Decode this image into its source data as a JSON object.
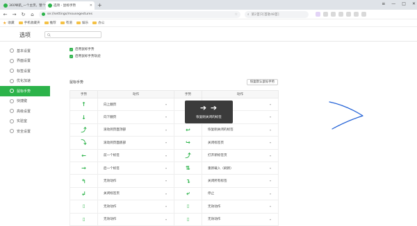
{
  "browser": {
    "tabs": [
      {
        "label": "360导航_一个主页，整个世界",
        "active": false,
        "icon_color": "#2cb34a"
      },
      {
        "label": "选项 - 鼠标手势",
        "active": true,
        "icon_color": "#2cb34a"
      }
    ],
    "new_tab": "+",
    "address": "se://settings/mousegestures",
    "search_text": "第2首只[首歌48首]",
    "bookmarks": [
      {
        "label": "收藏",
        "icon": "star-icon"
      },
      {
        "label": "手机收藏夹",
        "icon": "folder-icon"
      },
      {
        "label": "推荐",
        "icon": "folder-icon"
      },
      {
        "label": "有道",
        "icon": "folder-icon"
      },
      {
        "label": "娱乐",
        "icon": "folder-icon"
      },
      {
        "label": "办公",
        "icon": "folder-icon"
      }
    ]
  },
  "page": {
    "title": "选项",
    "search_placeholder": ""
  },
  "sidebar": {
    "items": [
      {
        "label": "基本设置",
        "active": false
      },
      {
        "label": "界面设置",
        "active": false
      },
      {
        "label": "标签设置",
        "active": false
      },
      {
        "label": "优化加速",
        "active": false
      },
      {
        "label": "鼠标手势",
        "active": true
      },
      {
        "label": "快捷键",
        "active": false
      },
      {
        "label": "高级设置",
        "active": false
      },
      {
        "label": "实验室",
        "active": false
      },
      {
        "label": "安全设置",
        "active": false
      }
    ]
  },
  "options": {
    "enable_gesture": "启用鼠标手势",
    "enable_trail": "启用鼠标手势轨迹"
  },
  "gestures": {
    "title": "鼠标手势",
    "restore_button": "恢复默认鼠标手势",
    "headers": [
      "手势",
      "动作",
      "手势",
      "动作"
    ],
    "rows": [
      {
        "g1": "up",
        "a1": "向上翻页",
        "g2": "right-up",
        "a2": ""
      },
      {
        "g1": "down",
        "a1": "向下翻页",
        "g2": "right-down",
        "a2": ""
      },
      {
        "g1": "up-left",
        "a1": "滚动到页面顶部",
        "g2": "down-left",
        "a2": "恢复刚关闭的标签"
      },
      {
        "g1": "down-left2",
        "a1": "滚动到页面底部",
        "g2": "down-right",
        "a2": "关闭标签页"
      },
      {
        "g1": "left",
        "a1": "前一个标签",
        "g2": "up-right",
        "a2": "打开新标签页"
      },
      {
        "g1": "right",
        "a1": "后一个标签",
        "g2": "up-down",
        "a2": "重新载入（刷新）"
      },
      {
        "g1": "left-up",
        "a1": "无效动作",
        "g2": "right-down2",
        "a2": "关闭所有标签"
      },
      {
        "g1": "left-down",
        "a1": "关闭标签页",
        "g2": "down-up-left",
        "a2": "停止"
      },
      {
        "g1": "mouse",
        "a1": "无效动作",
        "g2": "mouse",
        "a2": "无效动作"
      },
      {
        "g1": "mouse",
        "a1": "无效动作",
        "g2": "mouse",
        "a2": "无效动作"
      }
    ]
  },
  "toast": {
    "arrows": "➔➔",
    "message": "恢复刚关闭的标签"
  },
  "colors": {
    "accent": "#2cb34a",
    "drawing": "#1f5fd6"
  }
}
